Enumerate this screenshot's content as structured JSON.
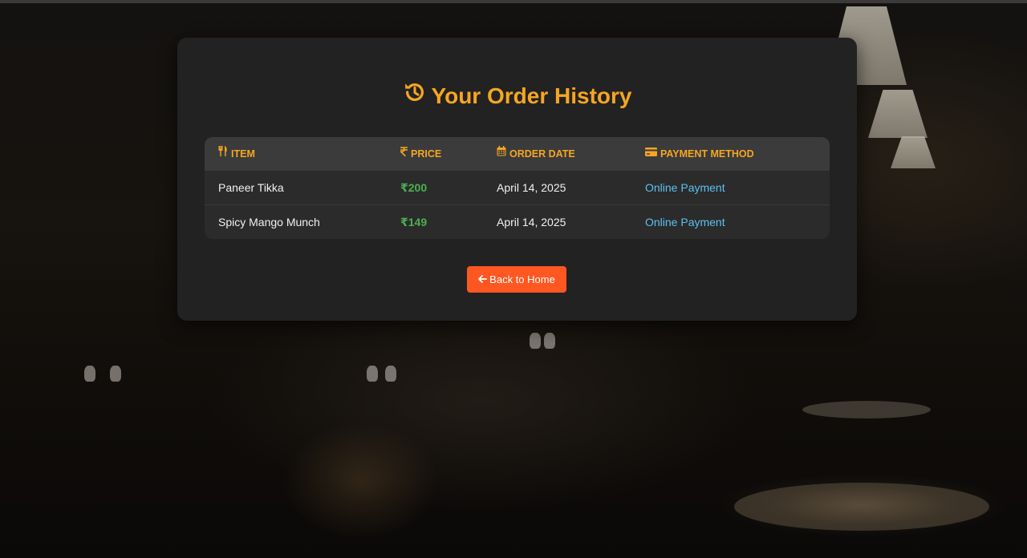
{
  "page": {
    "title": "Your Order History",
    "accent_color": "#f5a623",
    "button_color": "#ff5722",
    "price_color": "#4caf50",
    "link_color": "#5ec1f0"
  },
  "table": {
    "headers": {
      "item": "ITEM",
      "price": "PRICE",
      "order_date": "ORDER DATE",
      "payment_method": "PAYMENT METHOD"
    },
    "header_icons": {
      "item": "utensils-icon",
      "price": "rupee-icon",
      "order_date": "calendar-icon",
      "payment_method": "credit-card-icon"
    },
    "rows": [
      {
        "item": "Paneer Tikka",
        "price": "₹200",
        "order_date": "April 14, 2025",
        "payment_method": "Online Payment"
      },
      {
        "item": "Spicy Mango Munch",
        "price": "₹149",
        "order_date": "April 14, 2025",
        "payment_method": "Online Payment"
      }
    ]
  },
  "actions": {
    "back_label": "Back to Home",
    "back_icon": "arrow-left-icon"
  },
  "title_icon": "history-icon"
}
